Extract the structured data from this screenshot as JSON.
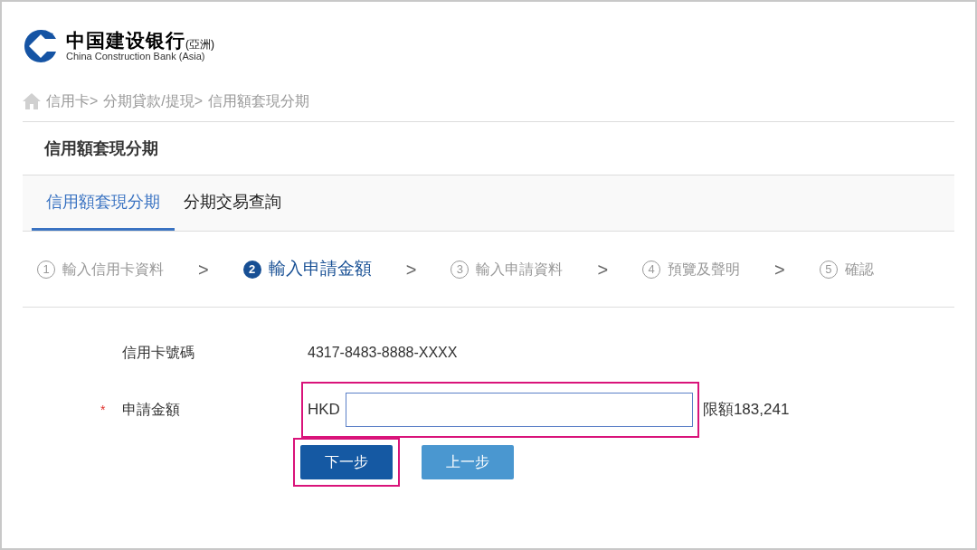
{
  "logo": {
    "name_zh": "中国建设银行",
    "suffix": "(亞洲)",
    "name_en": "China Construction Bank (Asia)"
  },
  "breadcrumb": [
    "信用卡>",
    "分期貸款/提現>",
    "信用額套現分期"
  ],
  "page_title": "信用額套現分期",
  "tabs": [
    {
      "label": "信用額套現分期",
      "selected": true
    },
    {
      "label": "分期交易查詢",
      "selected": false
    }
  ],
  "steps": [
    {
      "number": "1",
      "label": "輸入信用卡資料",
      "selected": false
    },
    {
      "number": "2",
      "label": "輸入申請金額",
      "selected": true
    },
    {
      "number": "3",
      "label": "輸入申請資料",
      "selected": false
    },
    {
      "number": "4",
      "label": "預覽及聲明",
      "selected": false
    },
    {
      "number": "5",
      "label": "確認",
      "selected": false
    }
  ],
  "step_separator": ">",
  "form": {
    "card_number_label": "信用卡號碼",
    "card_number": "4317-8483-8888-XXXX",
    "amount_required_mark": "*",
    "amount_label": "申請金額",
    "currency": "HKD",
    "amount_highlighted": true,
    "limit": "限額183,241"
  },
  "buttons": [
    {
      "label": "下一步",
      "kind": "primary",
      "highlighted": true
    },
    {
      "label": "上一步",
      "kind": "secondary",
      "highlighted": false
    }
  ]
}
